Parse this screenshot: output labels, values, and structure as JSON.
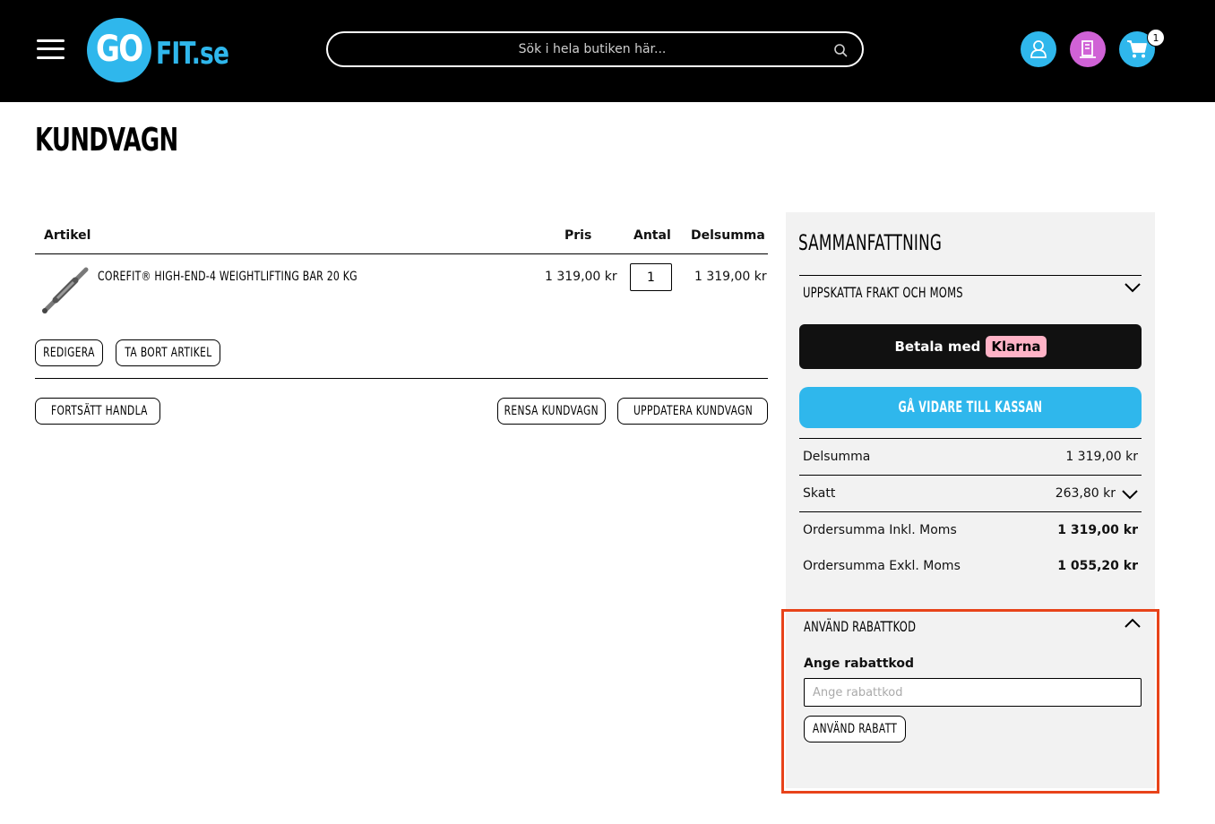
{
  "header": {
    "logo_go": "GO",
    "logo_fit": "FIT.se",
    "search_placeholder": "Sök i hela butiken här...",
    "cart_count": "1",
    "colors": {
      "brand_blue": "#2fb7ec",
      "wishlist_pink": "#d062d6",
      "header_bg": "#000000"
    }
  },
  "page": {
    "title": "KUNDVAGN"
  },
  "cart": {
    "columns": {
      "article": "Artikel",
      "price": "Pris",
      "qty": "Antal",
      "subtotal": "Delsumma"
    },
    "items": [
      {
        "name": "COREFIT® HIGH-END-4 WEIGHTLIFTING BAR 20 KG",
        "price": "1 319,00 kr",
        "qty": "1",
        "subtotal": "1 319,00 kr"
      }
    ],
    "actions": {
      "edit": "REDIGERA",
      "remove": "TA BORT ARTIKEL"
    },
    "footer": {
      "continue": "FORTSÄTT HANDLA",
      "clear": "RENSA KUNDVAGN",
      "update": "UPPDATERA KUNDVAGN"
    }
  },
  "summary": {
    "title": "SAMMANFATTNING",
    "shipping_toggle": "UPPSKATTA FRAKT OCH MOMS",
    "klarna": {
      "text": "Betala med",
      "brand": "Klarna"
    },
    "checkout": "GÅ VIDARE TILL KASSAN",
    "totals": {
      "subtotal_label": "Delsumma",
      "subtotal_value": "1 319,00 kr",
      "tax_label": "Skatt",
      "tax_value": "263,80 kr",
      "incl_label": "Ordersumma Inkl. Moms",
      "incl_value": "1 319,00 kr",
      "excl_label": "Ordersumma Exkl. Moms",
      "excl_value": "1 055,20 kr"
    }
  },
  "discount": {
    "title": "ANVÄND RABATTKOD",
    "label": "Ange rabattkod",
    "placeholder": "Ange rabattkod",
    "apply": "ANVÄND RABATT",
    "highlight_color": "#e8431a"
  }
}
